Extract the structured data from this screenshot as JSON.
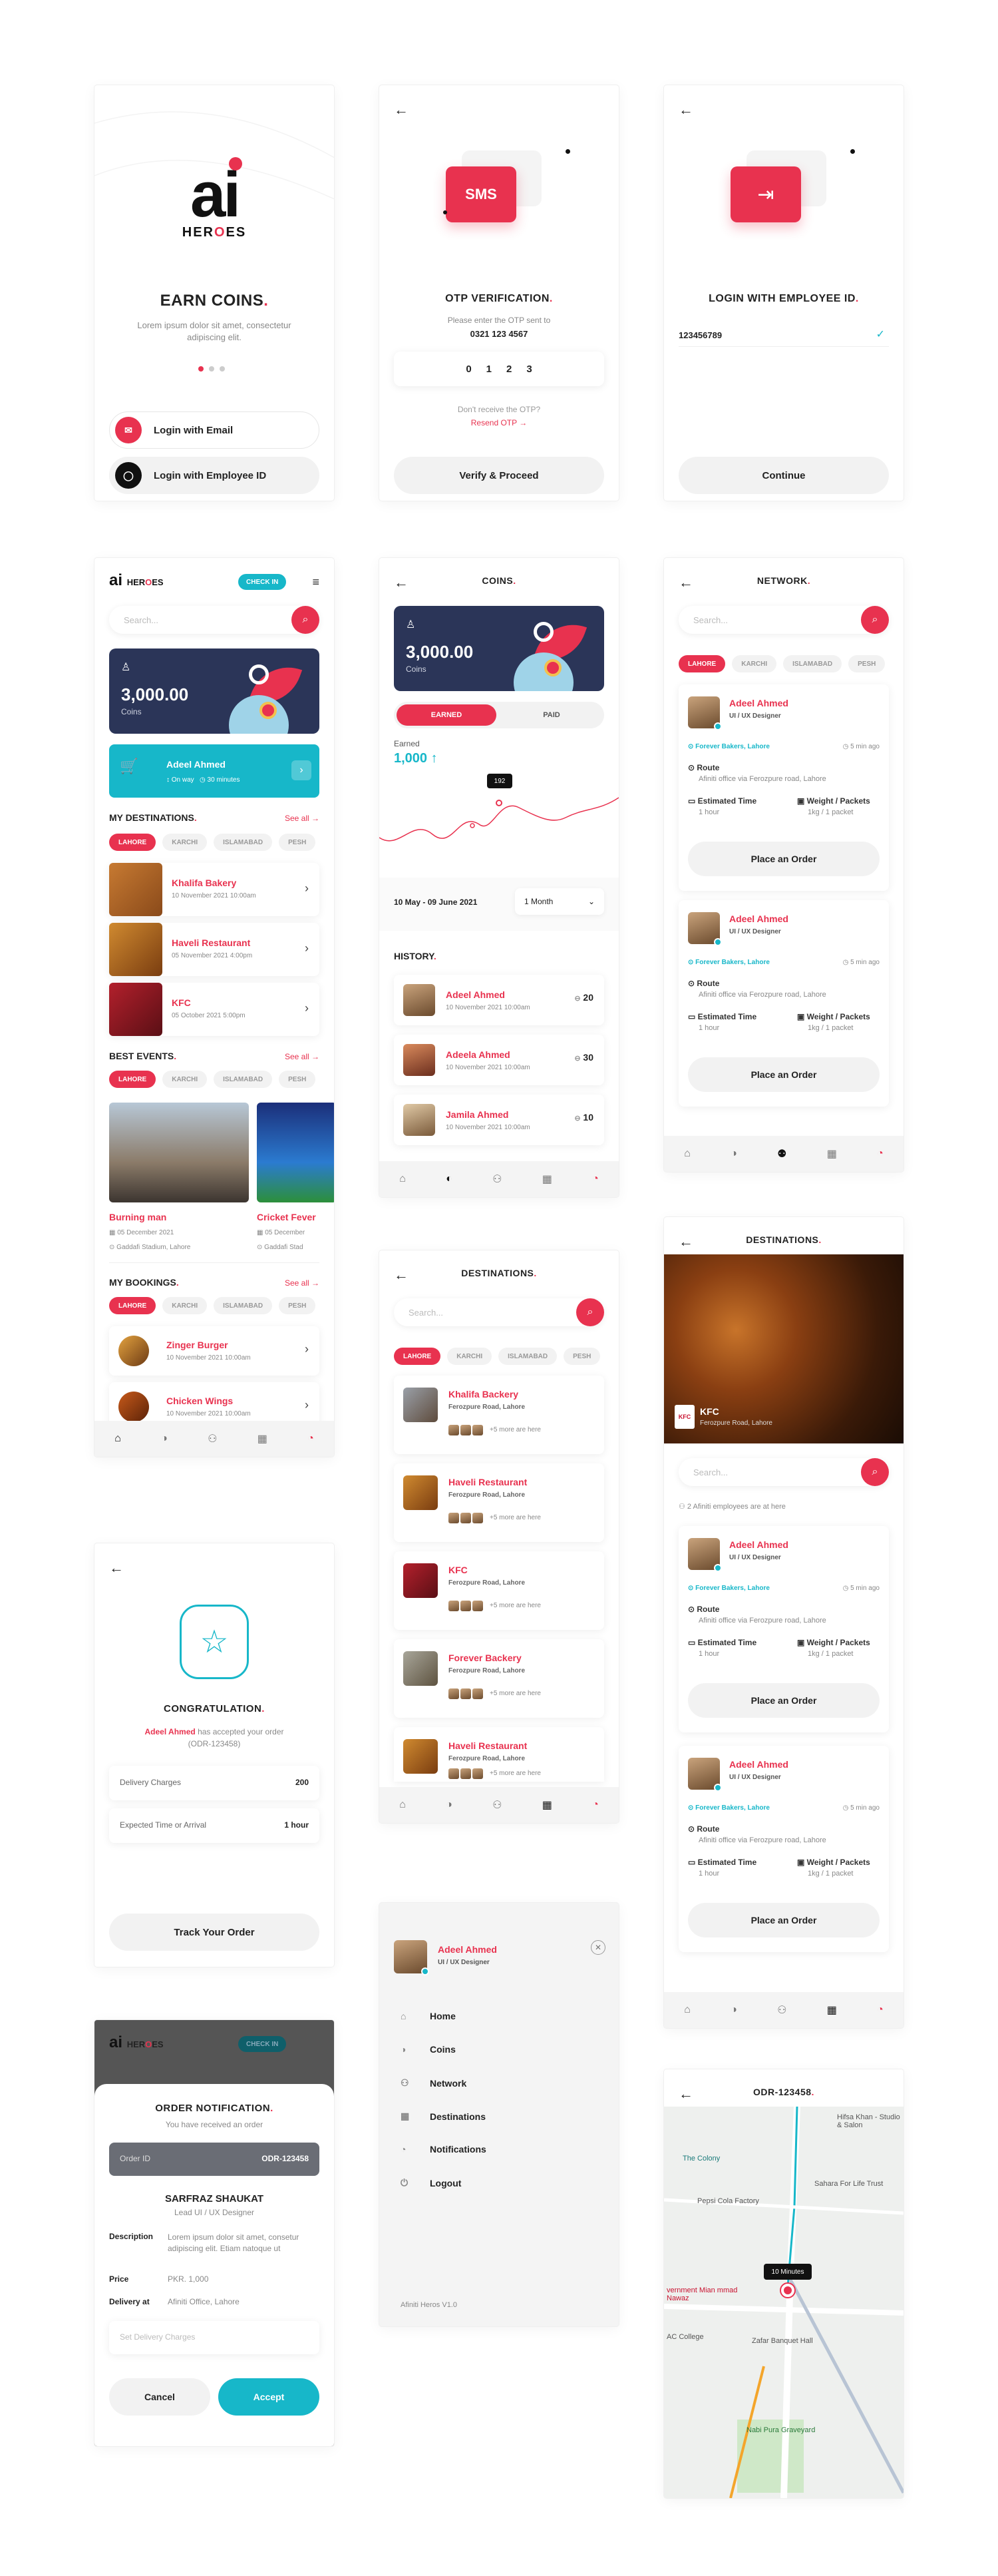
{
  "colors": {
    "accent": "#e8324f",
    "teal": "#17b7c9",
    "navy": "#2b3558"
  },
  "brand": {
    "logo": "ai",
    "name_a": "HER",
    "name_o": "O",
    "name_b": "ES"
  },
  "welcome": {
    "title": "EARN COINS",
    "desc": "Lorem ipsum dolor sit amet, consectetur adipiscing elit.",
    "btn_email": "Login with Email",
    "btn_employee": "Login with Employee ID"
  },
  "otp": {
    "badge": "SMS",
    "title": "OTP VERIFICATION",
    "text": "Please enter the OTP sent to",
    "phone": "0321 123 4567",
    "digits": [
      "0",
      "1",
      "2",
      "3"
    ],
    "not_received": "Don't receive the OTP?",
    "resend": "Resend OTP",
    "resend_arrow": "→",
    "button": "Verify & Proceed"
  },
  "employee_login": {
    "title": "LOGIN WITH EMPLOYEE ID",
    "value": "123456789",
    "button": "Continue"
  },
  "home": {
    "check_in": "CHECK IN",
    "search_placeholder": "Search...",
    "coins": "3,000.00",
    "coins_label": "Coins",
    "delivery": {
      "name": "Adeel Ahmed",
      "status": "On way",
      "time": "30 minutes"
    },
    "destinations_title": "MY DESTINATIONS",
    "see_all": "See all →",
    "chips": [
      "LAHORE",
      "KARCHI",
      "ISLAMABAD",
      "PESH"
    ],
    "destinations": [
      {
        "name": "Khalifa Bakery",
        "date": "10 November 2021 10:00am"
      },
      {
        "name": "Haveli Restaurant",
        "date": "05 November 2021 4:00pm"
      },
      {
        "name": "KFC",
        "date": "05 October 2021 5:00pm"
      }
    ],
    "events_title": "BEST EVENTS",
    "events": [
      {
        "name": "Burning man",
        "date": "05 December 2021",
        "place": "Gaddafi Stadium, Lahore"
      },
      {
        "name": "Cricket Fever",
        "date": "05 December",
        "place": "Gaddafi Stad"
      }
    ],
    "bookings_title": "MY BOOKINGS",
    "bookings": [
      {
        "name": "Zinger Burger",
        "date": "10 November 2021 10:00am"
      },
      {
        "name": "Chicken Wings",
        "date": "10 November 2021 10:00am"
      }
    ]
  },
  "coins": {
    "title": "COINS",
    "amount": "3,000.00",
    "label": "Coins",
    "tab_earned": "EARNED",
    "tab_paid": "PAID",
    "earned_label": "Earned",
    "earned_value": "1,000 ↑",
    "tooltip": "192",
    "range": "10 May - 09 June 2021",
    "period": "1 Month",
    "history_title": "HISTORY",
    "history": [
      {
        "name": "Adeel Ahmed",
        "date": "10 November 2021 10:00am",
        "coins": "20"
      },
      {
        "name": "Adeela Ahmed",
        "date": "10 November 2021 10:00am",
        "coins": "30"
      },
      {
        "name": "Jamila Ahmed",
        "date": "10 November 2021 10:00am",
        "coins": "10"
      }
    ]
  },
  "network": {
    "title": "NETWORK",
    "person": {
      "name": "Adeel Ahmed",
      "role": "UI / UX Designer",
      "place": "Forever Bakers, Lahore",
      "ago": "5 min ago",
      "route_label": "Route",
      "route": "Afiniti office via Ferozpure road, Lahore",
      "time_label": "Estimated Time",
      "time": "1 hour",
      "weight_label": "Weight / Packets",
      "weight": "1kg / 1 packet",
      "button": "Place an Order"
    }
  },
  "destinations_list": {
    "title": "DESTINATIONS",
    "more": "+5 more are here",
    "items": [
      {
        "name": "Khalifa Backery",
        "addr": "Ferozpure Road, Lahore"
      },
      {
        "name": "Haveli Restaurant",
        "addr": "Ferozpure Road, Lahore"
      },
      {
        "name": "KFC",
        "addr": "Ferozpure Road, Lahore"
      },
      {
        "name": "Forever Backery",
        "addr": "Ferozpure Road, Lahore"
      },
      {
        "name": "Haveli Restaurant",
        "addr": "Ferozpure Road, Lahore"
      }
    ]
  },
  "dest_detail": {
    "title": "DESTINATIONS",
    "place": "KFC",
    "addr": "Ferozpure Road, Lahore",
    "employees": "2 Afiniti employees are at here"
  },
  "congrats": {
    "title": "CONGRATULATION",
    "person": "Adeel Ahmed",
    "text": "has accepted your order (ODR-123458)",
    "rows": [
      {
        "k": "Delivery Charges",
        "v": "200"
      },
      {
        "k": "Expected Time or Arrival",
        "v": "1 hour"
      }
    ],
    "button": "Track Your Order"
  },
  "drawer": {
    "name": "Adeel Ahmed",
    "role": "UI / UX Designer",
    "items": [
      "Home",
      "Coins",
      "Network",
      "Destinations",
      "Notifications",
      "Logout"
    ],
    "version": "Afiniti Heros V1.0"
  },
  "order_notif": {
    "title": "ORDER NOTIFICATION",
    "subtitle": "You have received an order",
    "order_label": "Order ID",
    "order_id": "ODR-123458",
    "person": "SARFRAZ SHAUKAT",
    "role": "Lead UI / UX Designer",
    "desc_label": "Description",
    "desc": "Lorem ipsum dolor sit amet, consetur adipiscing elit. Etiam natoque ut",
    "price_label": "Price",
    "price": "PKR. 1,000",
    "delivery_label": "Delivery at",
    "delivery": "Afiniti Office, Lahore",
    "placeholder": "Set Delivery Charges",
    "cancel": "Cancel",
    "accept": "Accept"
  },
  "map": {
    "title": "ODR-123458",
    "callout": "10 Minutes",
    "labels": [
      "The Colony",
      "Pepsi Cola Factory",
      "Sahara For Life Trust",
      "Hifsa Khan - Studio & Salon",
      "Zafar Banquet Hall",
      "Nabi Pura Graveyard",
      "AC College",
      "vernment Mian mmad Nawaz"
    ]
  }
}
